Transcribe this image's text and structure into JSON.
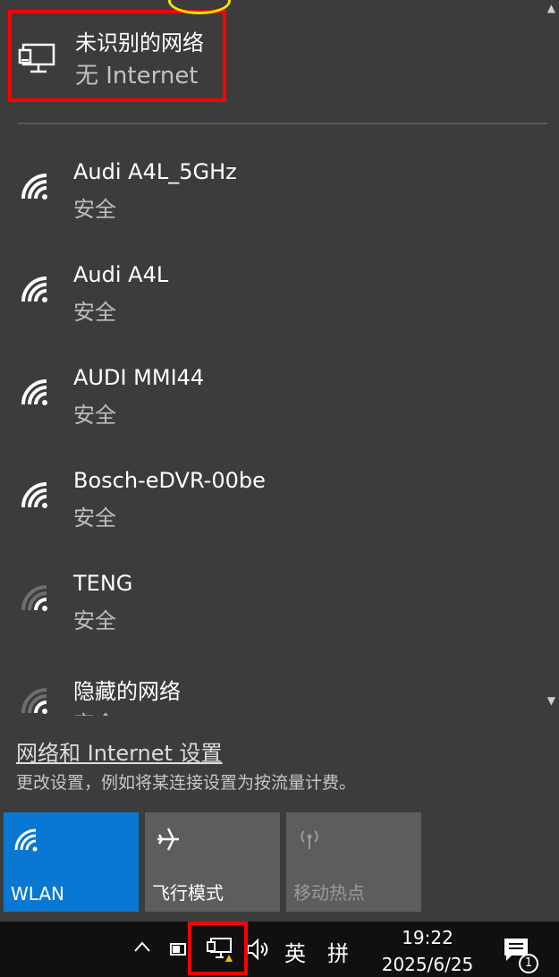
{
  "current_network": {
    "name": "未识别的网络",
    "status": "无 Internet"
  },
  "networks": [
    {
      "name": "Audi A4L_5GHz",
      "security": "安全",
      "signal": "full"
    },
    {
      "name": "Audi A4L",
      "security": "安全",
      "signal": "full"
    },
    {
      "name": "AUDI MMI44",
      "security": "安全",
      "signal": "full"
    },
    {
      "name": "Bosch-eDVR-00be",
      "security": "安全",
      "signal": "full"
    },
    {
      "name": "TENG",
      "security": "安全",
      "signal": "weak"
    },
    {
      "name": "隐藏的网络",
      "security": "安全",
      "signal": "weak"
    }
  ],
  "settings": {
    "link": "网络和 Internet 设置",
    "description": "更改设置，例如将某连接设置为按流量计费。"
  },
  "quick_actions": [
    {
      "label": "WLAN",
      "icon": "wifi-icon",
      "state": "on"
    },
    {
      "label": "飞行模式",
      "icon": "airplane-icon",
      "state": "off"
    },
    {
      "label": "移动热点",
      "icon": "hotspot-icon",
      "state": "disabled"
    }
  ],
  "taskbar": {
    "ime_lang": "英",
    "ime_mode": "拼",
    "time": "19:22",
    "date": "2025/6/25",
    "notification_count": "1"
  },
  "colors": {
    "panel_bg": "#3c3c3c",
    "accent": "#0a78d2",
    "highlight": "#ff0000",
    "taskbar_bg": "#101010"
  }
}
